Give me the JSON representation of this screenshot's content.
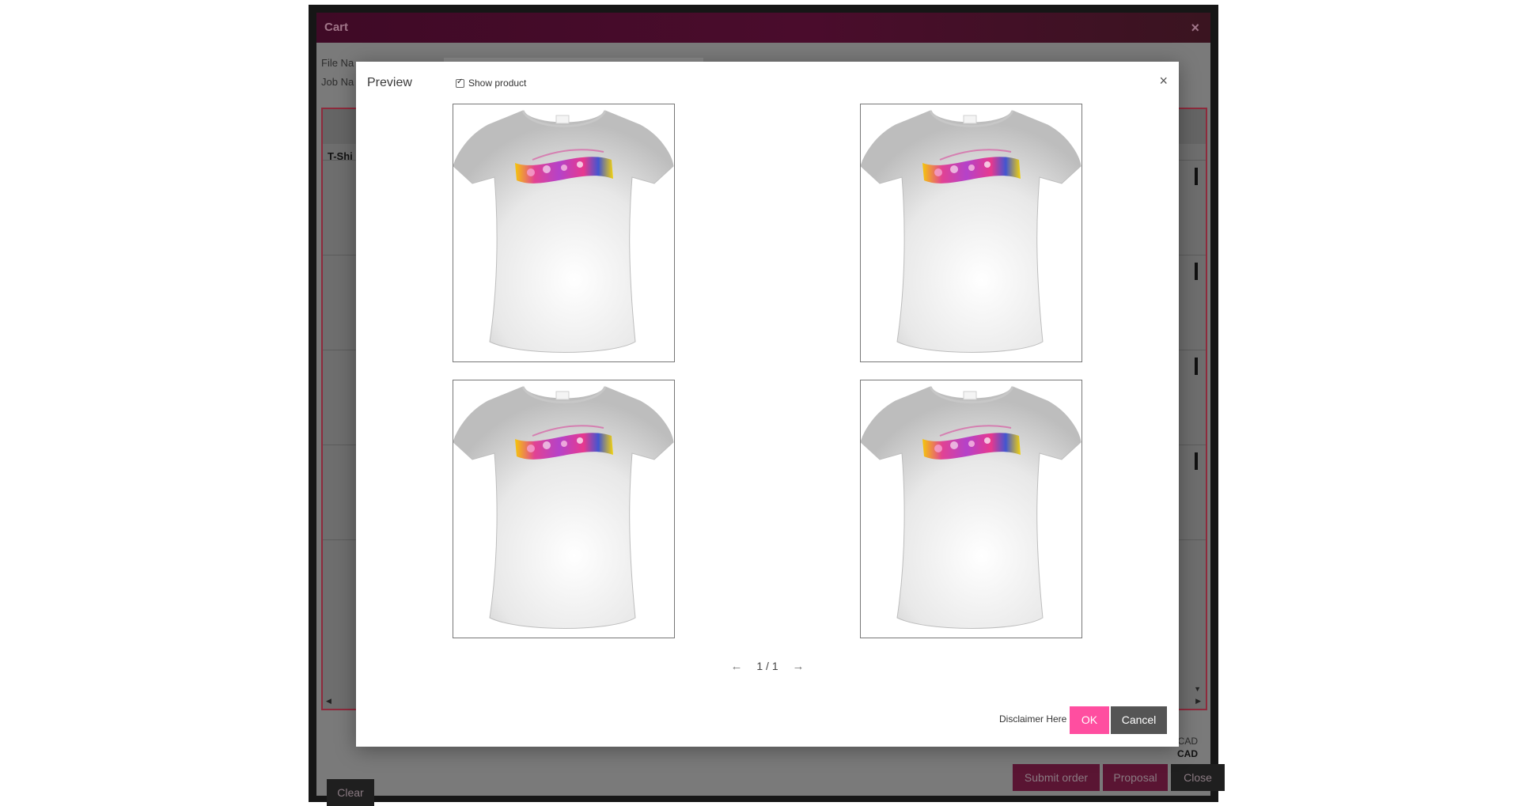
{
  "cart": {
    "title": "Cart",
    "close_icon": "×",
    "file_name_label": "File Na",
    "job_name_label": "Job Na",
    "row_label": "T-Shi",
    "currency_1": "CAD",
    "currency_2": "CAD",
    "submit_label": "Submit order",
    "proposal_label": "Proposal",
    "close_label": "Close",
    "clear_label": "Clear"
  },
  "preview": {
    "title": "Preview",
    "show_product_label": "Show product",
    "show_product_checked": true,
    "close_icon": "×",
    "items": [
      {
        "name": "preview-shirt-1"
      },
      {
        "name": "preview-shirt-2"
      },
      {
        "name": "preview-shirt-3"
      },
      {
        "name": "preview-shirt-4"
      }
    ],
    "pager": {
      "prev_icon": "←",
      "info": "1 / 1",
      "next_icon": "→"
    },
    "disclaimer": "Disclaimer Here",
    "ok_label": "OK",
    "cancel_label": "Cancel"
  },
  "colors": {
    "accent_pink": "#ff4ea0",
    "cart_header": "#4a0c2c",
    "cancel_gray": "#555555"
  }
}
